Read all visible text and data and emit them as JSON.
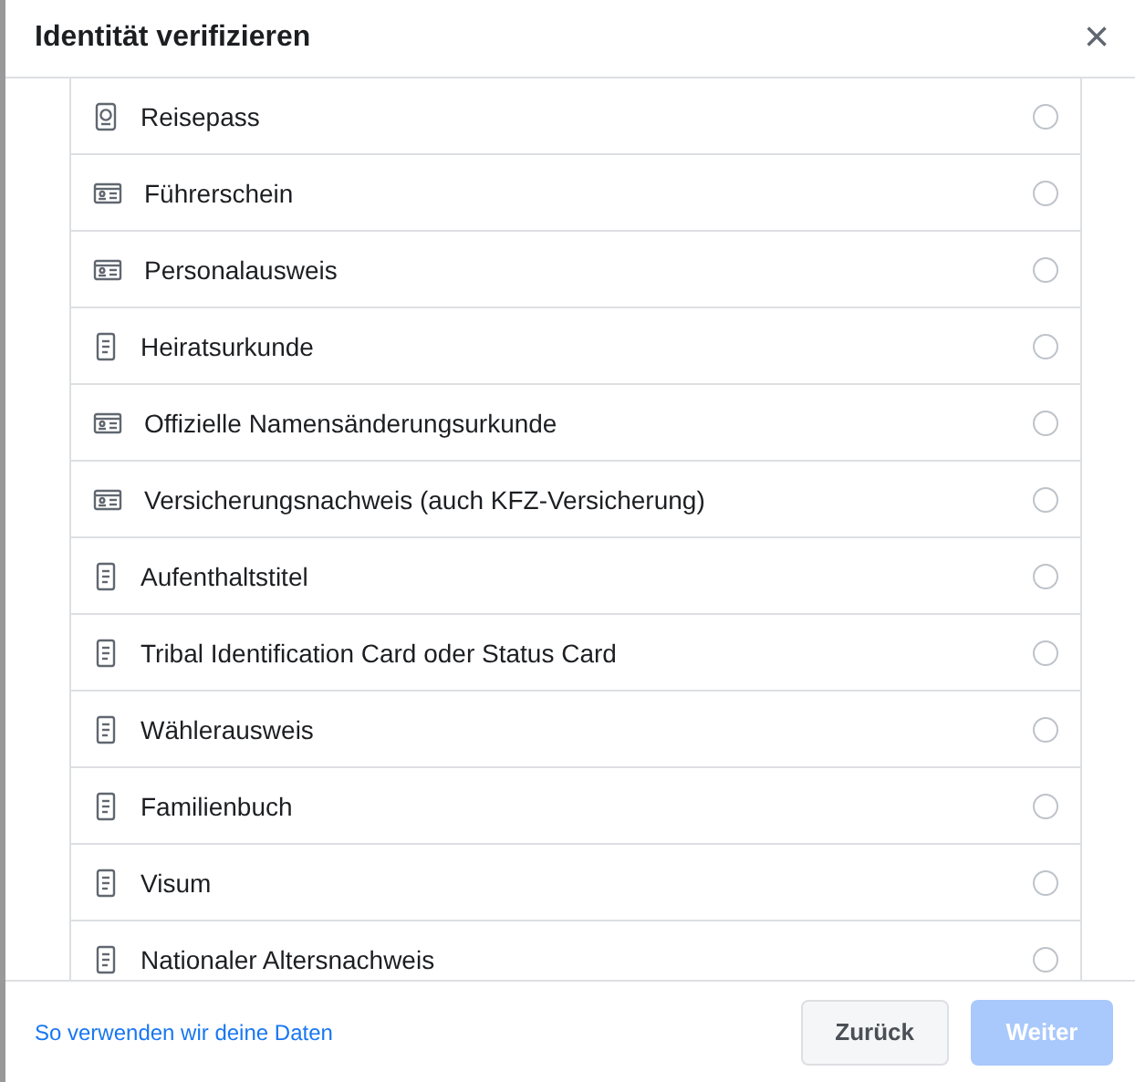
{
  "dialog": {
    "title": "Identität verifizieren",
    "close": "×"
  },
  "options": [
    {
      "label": "Reisepass",
      "kind": "passport",
      "selected": false
    },
    {
      "label": "Führerschein",
      "kind": "card",
      "selected": false
    },
    {
      "label": "Personalausweis",
      "kind": "card",
      "selected": false
    },
    {
      "label": "Heiratsurkunde",
      "kind": "document",
      "selected": false
    },
    {
      "label": "Offizielle Namensänderungsurkunde",
      "kind": "card",
      "selected": false
    },
    {
      "label": "Versicherungsnachweis (auch KFZ-Versicherung)",
      "kind": "card",
      "selected": false
    },
    {
      "label": "Aufenthaltstitel",
      "kind": "document",
      "selected": false
    },
    {
      "label": "Tribal Identification Card oder Status Card",
      "kind": "document",
      "selected": false
    },
    {
      "label": "Wählerausweis",
      "kind": "document",
      "selected": false
    },
    {
      "label": "Familienbuch",
      "kind": "document",
      "selected": false
    },
    {
      "label": "Visum",
      "kind": "document",
      "selected": false
    },
    {
      "label": "Nationaler Altersnachweis",
      "kind": "document",
      "selected": false
    }
  ],
  "footer": {
    "link": "So verwenden wir deine Daten",
    "back": {
      "label": "Zurück",
      "disabled": false
    },
    "next": {
      "label": "Weiter",
      "disabled": true
    }
  }
}
